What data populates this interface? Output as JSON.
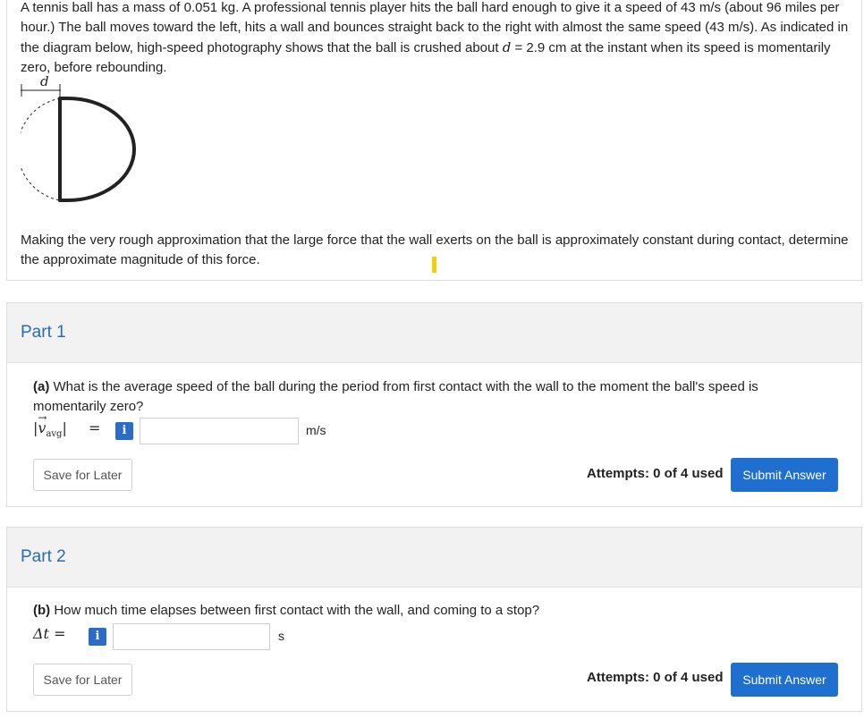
{
  "problem": {
    "paragraph1_a": "A tennis ball has a mass of 0.051 kg. A professional tennis player hits the ball hard enough to give it a speed of 43 m/s (about 96 miles per hour.) The ball moves toward the left, hits a wall and bounces straight back to the right with almost the same speed (43 m/s). As indicated in the diagram below, high-speed photography shows that the ball is crushed about ",
    "paragraph1_var": "d",
    "paragraph1_b": " = 2.9 cm at the instant when its speed is momentarily zero, before rebounding.",
    "diagram_label": "d",
    "paragraph2": "Making the very rough approximation that the large force that the wall exerts on the ball is approximately constant during contact, determine the approximate magnitude of this force."
  },
  "parts": [
    {
      "title": "Part 1",
      "question_label": "(a)",
      "question_text": " What is the average speed of the ball during the period from first contact with the wall to the moment the ball's speed is momentarily zero?",
      "symbol_v": "v",
      "symbol_sub": "avg",
      "equals": "=",
      "info_label": "i",
      "value": "",
      "unit": "m/s",
      "save_label": "Save for Later",
      "attempts": "Attempts: 0 of 4 used",
      "submit_label": "Submit Answer"
    },
    {
      "title": "Part 2",
      "question_label": "(b)",
      "question_text": " How much time elapses between first contact with the wall, and coming to a stop?",
      "symbol": "Δt =",
      "info_label": "i",
      "value": "",
      "unit": "s",
      "save_label": "Save for Later",
      "attempts": "Attempts: 0 of 4 used",
      "submit_label": "Submit Answer"
    }
  ],
  "colors": {
    "accent": "#1f6fd1",
    "part_title": "#2b6cb0",
    "cursor": "#f3d200"
  }
}
